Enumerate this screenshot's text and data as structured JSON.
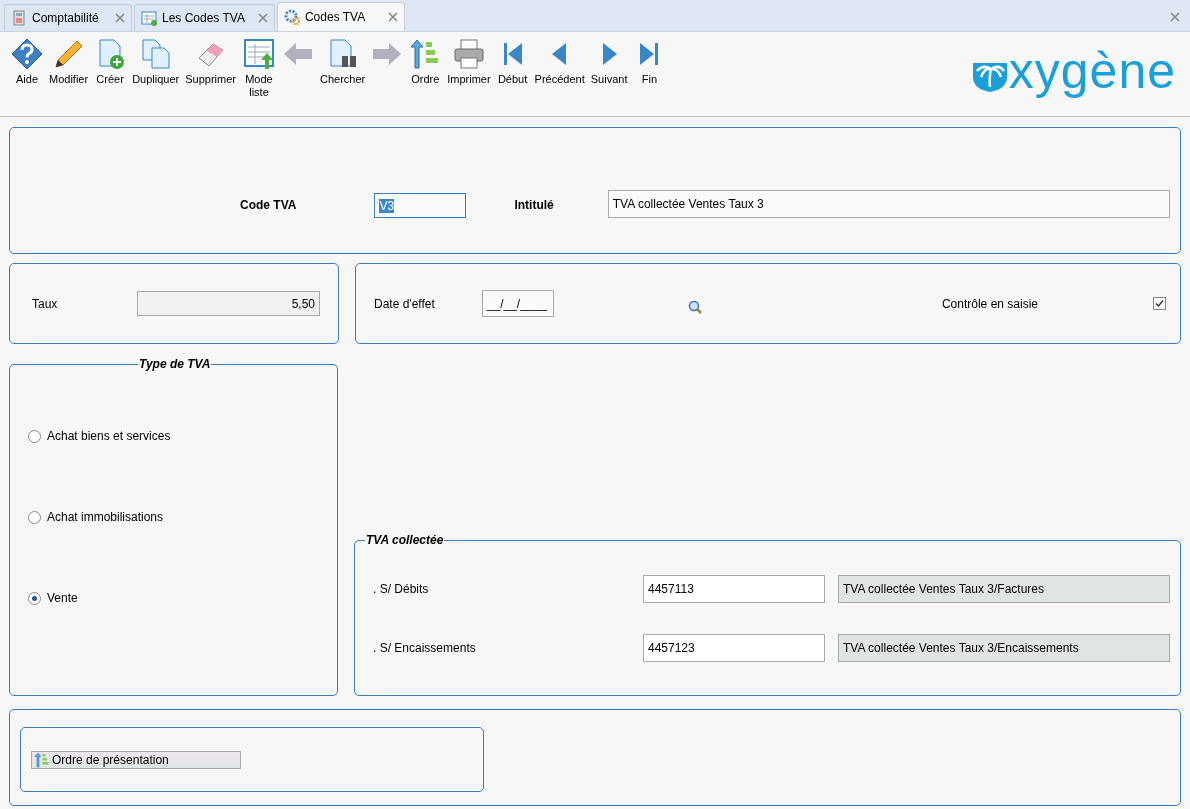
{
  "tabs": [
    {
      "label": "Comptabilité",
      "kind": "calc",
      "selected": false
    },
    {
      "label": "Les Codes TVA",
      "kind": "list",
      "selected": false
    },
    {
      "label": "Codes TVA",
      "kind": "gear",
      "selected": true
    }
  ],
  "toolbar": [
    {
      "label": "Aide",
      "kind": "help",
      "disabled": false
    },
    {
      "label": "Modifier",
      "kind": "pencil",
      "disabled": false
    },
    {
      "label": "Créer",
      "kind": "new",
      "disabled": false
    },
    {
      "label": "Dupliquer",
      "kind": "copy",
      "disabled": false
    },
    {
      "label": "Supprimer",
      "kind": "eraser",
      "disabled": false
    },
    {
      "label": "Mode liste",
      "kind": "listmode",
      "disabled": false
    },
    {
      "kind": "back",
      "disabled": true
    },
    {
      "label": "Chercher",
      "kind": "find",
      "disabled": false
    },
    {
      "kind": "forward",
      "disabled": true
    },
    {
      "label": "Ordre",
      "kind": "order",
      "disabled": false
    },
    {
      "label": "Imprimer",
      "kind": "print",
      "disabled": false
    },
    {
      "label": "Début",
      "kind": "first",
      "disabled": false
    },
    {
      "label": "Précédent",
      "kind": "prev",
      "disabled": false
    },
    {
      "label": "Suivant",
      "kind": "next",
      "disabled": false
    },
    {
      "label": "Fin",
      "kind": "last",
      "disabled": false
    }
  ],
  "logo": {
    "text": "xygène"
  },
  "header": {
    "code_label": "Code TVA",
    "code_value": "V3",
    "intitule_label": "Intitulé",
    "intitule_value": "TVA collectée Ventes Taux 3"
  },
  "taux": {
    "label": "Taux",
    "value": "5,50"
  },
  "effet": {
    "label": "Date d'effet",
    "value": "__/__/____",
    "controle_label": "Contrôle en saisie",
    "controle_checked": true
  },
  "type_tva": {
    "legend": "Type de TVA",
    "options": [
      {
        "label": "Achat biens et services",
        "selected": false
      },
      {
        "label": "Achat immobilisations",
        "selected": false
      },
      {
        "label": "Vente",
        "selected": true
      }
    ]
  },
  "tva_collectee": {
    "legend": "TVA collectée",
    "rows": [
      {
        "label": ". S/ Débits",
        "account": "4457113",
        "description": "TVA collectée Ventes Taux 3/Factures"
      },
      {
        "label": ". S/ Encaissements",
        "account": "4457123",
        "description": "TVA collectée Ventes Taux 3/Encaissements"
      }
    ]
  },
  "ordre_button": "Ordre de présentation"
}
